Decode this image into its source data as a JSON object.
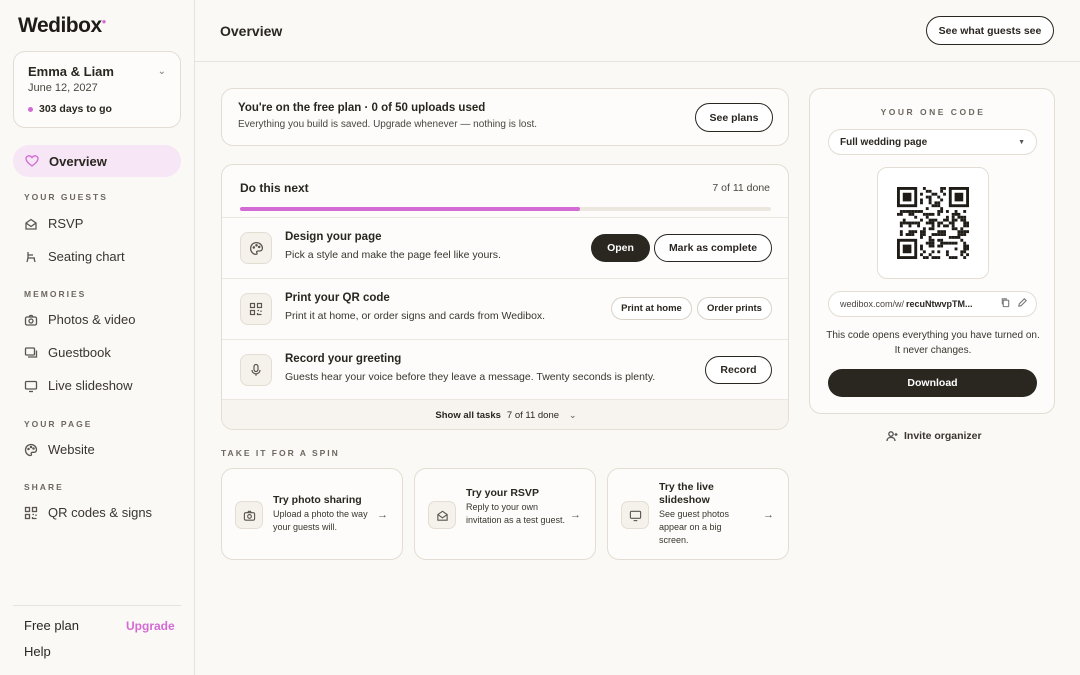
{
  "brand": {
    "logo": "Wedibox",
    "accent": "#d46ad4",
    "dark": "#2a2620"
  },
  "couple": {
    "names": "Emma & Liam",
    "date": "June 12, 2027",
    "countdown": "303 days to go"
  },
  "sidebar": {
    "active": {
      "label": "Overview",
      "icon": "heart-icon"
    },
    "sections": [
      {
        "title": "YOUR GUESTS",
        "items": [
          {
            "label": "RSVP",
            "icon": "envelope-icon"
          },
          {
            "label": "Seating chart",
            "icon": "chair-icon"
          }
        ]
      },
      {
        "title": "MEMORIES",
        "items": [
          {
            "label": "Photos & video",
            "icon": "camera-icon"
          },
          {
            "label": "Guestbook",
            "icon": "message-icon"
          },
          {
            "label": "Live slideshow",
            "icon": "monitor-icon"
          }
        ]
      },
      {
        "title": "YOUR PAGE",
        "items": [
          {
            "label": "Website",
            "icon": "palette-icon"
          }
        ]
      },
      {
        "title": "SHARE",
        "items": [
          {
            "label": "QR codes & signs",
            "icon": "qr-icon"
          }
        ]
      }
    ],
    "plan": "Free plan",
    "upgrade": "Upgrade",
    "help": "Help"
  },
  "header": {
    "title": "Overview",
    "preview_button": "See what guests see"
  },
  "plan_banner": {
    "title": "You're on the free plan · 0 of 50 uploads used",
    "subtitle": "Everything you build is saved. Upgrade whenever — nothing is lost.",
    "button": "See plans"
  },
  "tasks": {
    "heading": "Do this next",
    "count": "7 of 11 done",
    "progress": 0.64,
    "items": [
      {
        "title": "Design your page",
        "subtitle": "Pick a style and make the page feel like yours.",
        "icon": "palette-icon",
        "primary": "Open",
        "secondary": "Mark as complete"
      },
      {
        "title": "Print your QR code",
        "subtitle": "Print it at home, or order signs and cards from Wedibox.",
        "icon": "qr-icon",
        "primary": "Print at home",
        "secondary": "Order prints"
      },
      {
        "title": "Record your greeting",
        "subtitle": "Guests hear your voice before they leave a message. Twenty seconds is plenty.",
        "icon": "microphone-icon",
        "primary": "Record"
      }
    ],
    "show_all": "Show all tasks",
    "show_all_count": "7 of 11 done"
  },
  "spin": {
    "label": "TAKE IT FOR A SPIN",
    "cards": [
      {
        "title": "Try photo sharing",
        "desc": "Upload a photo the way your guests will.",
        "icon": "camera-icon"
      },
      {
        "title": "Try your RSVP",
        "desc": "Reply to your own invitation as a test guest.",
        "icon": "envelope-icon"
      },
      {
        "title": "Try the live slideshow",
        "desc": "See guest photos appear on a big screen.",
        "icon": "monitor-icon"
      }
    ]
  },
  "qr": {
    "label": "YOUR ONE CODE",
    "select": "Full wedding page",
    "link_base": "wedibox.com/w/",
    "link_code": "recuNtwvpTM...",
    "note": "This code opens everything you have turned on. It never changes.",
    "download": "Download"
  },
  "invite": "Invite organizer"
}
